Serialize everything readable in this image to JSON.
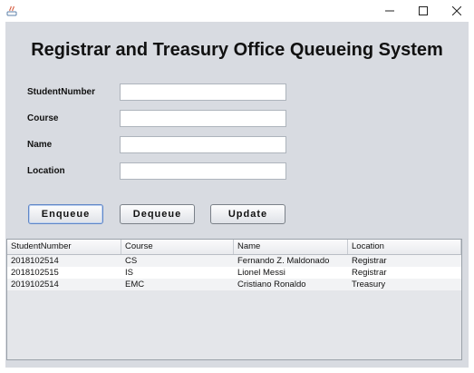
{
  "window": {
    "title": "",
    "controls": {
      "minimize_icon": "minimize-icon",
      "maximize_icon": "maximize-icon",
      "close_icon": "close-icon"
    }
  },
  "header": {
    "title": "Registrar and Treasury Office Queueing System"
  },
  "form": {
    "student_number": {
      "label": "StudentNumber",
      "value": ""
    },
    "course": {
      "label": "Course",
      "value": ""
    },
    "name": {
      "label": "Name",
      "value": ""
    },
    "location": {
      "label": "Location",
      "value": ""
    }
  },
  "buttons": {
    "enqueue": "Enqueue",
    "dequeue": "Dequeue",
    "update": "Update"
  },
  "table": {
    "columns": [
      "StudentNumber",
      "Course",
      "Name",
      "Location"
    ],
    "rows": [
      [
        "2018102514",
        "CS",
        "Fernando Z. Maldonado",
        "Registrar"
      ],
      [
        "2018102515",
        "IS",
        "Lionel Messi",
        "Registrar"
      ],
      [
        "2019102514",
        "EMC",
        "Cristiano Ronaldo",
        "Treasury"
      ]
    ]
  },
  "colors": {
    "panel_bg": "#d8dbe1",
    "accent_focus": "#5f86c7"
  }
}
